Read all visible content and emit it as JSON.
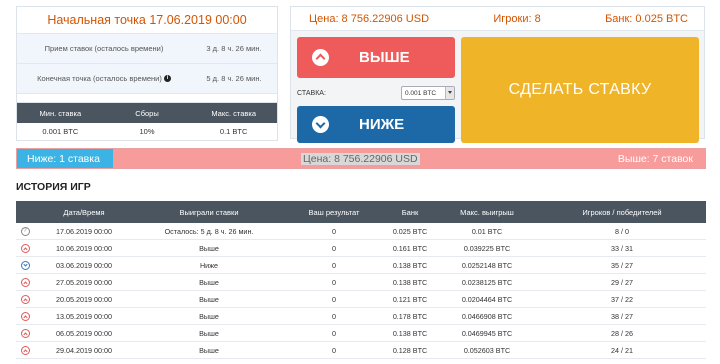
{
  "left": {
    "start_title": "Начальная точка 17.06.2019 00:00",
    "rows": [
      {
        "label": "Прием ставок (осталось времени)",
        "value": "3 д. 8 ч. 26 мин.",
        "info": false
      },
      {
        "label": "Конечная точка (осталось времени)",
        "value": "5 д. 8 ч. 26 мин.",
        "info": true
      }
    ],
    "fees_head": [
      "Мин. ставка",
      "Сборы",
      "Макс. ставка"
    ],
    "fees_values": [
      "0.001 BTC",
      "10%",
      "0.1 BTC"
    ]
  },
  "game": {
    "price": "Цена: 8 756.22906 USD",
    "players": "Игроки: 8",
    "bank": "Банк: 0.025 BTC",
    "up_label": "ВЫШЕ",
    "down_label": "НИЖЕ",
    "stake_label": "СТАВКА:",
    "stake_value": "0.001 BTC",
    "bet_label": "СДЕЛАТЬ СТАВКУ"
  },
  "progress": {
    "low": "Ниже: 1 ставка",
    "price": "Цена: 8 756.22906 USD",
    "high": "Выше: 7 ставок",
    "low_fraction": 0.14
  },
  "history": {
    "title": "ИСТОРИЯ ИГР",
    "columns": [
      "Дата/Время",
      "Выиграли ставки",
      "Ваш результат",
      "Банк",
      "Макс. выигрыш",
      "Игроков / победителей"
    ],
    "rows": [
      {
        "icon": "pending",
        "date": "17.06.2019 00:00",
        "won": "Осталось: 5 д. 8 ч. 26 мин.",
        "result": "0",
        "bank": "0.025 BTC",
        "max": "0.01 BTC",
        "players": "8 / 0"
      },
      {
        "icon": "up",
        "date": "10.06.2019 00:00",
        "won": "Выше",
        "result": "0",
        "bank": "0.161 BTC",
        "max": "0.039225 BTC",
        "players": "33 / 31"
      },
      {
        "icon": "down",
        "date": "03.06.2019 00:00",
        "won": "Ниже",
        "result": "0",
        "bank": "0.138 BTC",
        "max": "0.0252148 BTC",
        "players": "35 / 27"
      },
      {
        "icon": "up",
        "date": "27.05.2019 00:00",
        "won": "Выше",
        "result": "0",
        "bank": "0.138 BTC",
        "max": "0.0238125 BTC",
        "players": "29 / 27"
      },
      {
        "icon": "up",
        "date": "20.05.2019 00:00",
        "won": "Выше",
        "result": "0",
        "bank": "0.121 BTC",
        "max": "0.0204464 BTC",
        "players": "37 / 22"
      },
      {
        "icon": "up",
        "date": "13.05.2019 00:00",
        "won": "Выше",
        "result": "0",
        "bank": "0.178 BTC",
        "max": "0.0466908 BTC",
        "players": "38 / 27"
      },
      {
        "icon": "up",
        "date": "06.05.2019 00:00",
        "won": "Выше",
        "result": "0",
        "bank": "0.138 BTC",
        "max": "0.0469945 BTC",
        "players": "28 / 26"
      },
      {
        "icon": "up",
        "date": "29.04.2019 00:00",
        "won": "Выше",
        "result": "0",
        "bank": "0.128 BTC",
        "max": "0.052603 BTC",
        "players": "24 / 21"
      }
    ]
  }
}
